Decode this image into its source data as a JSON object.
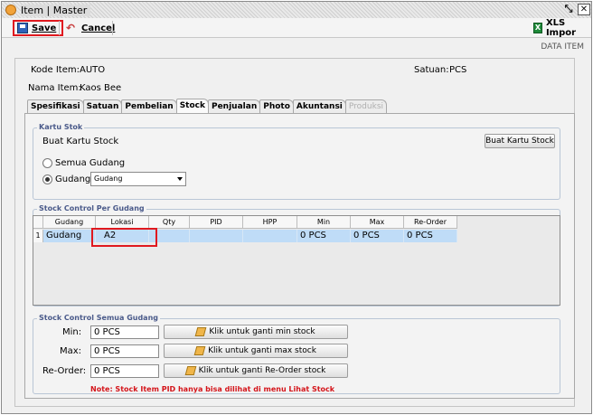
{
  "window": {
    "title": "Item | Master",
    "restore_icon": "restore-icon",
    "close_icon": "close-icon"
  },
  "toolbar": {
    "save_label": "Save",
    "cancel_label": "Cancel",
    "xls_label": "XLS Impor"
  },
  "header_caption": "DATA ITEM",
  "item": {
    "kode_label": "Kode Item:",
    "kode_value": "AUTO",
    "nama_label": "Nama Item:",
    "nama_value": "Kaos Bee",
    "satuan_label": "Satuan:",
    "satuan_value": "PCS"
  },
  "tabs": [
    {
      "label": "Spesifikasi",
      "active": false,
      "disabled": false
    },
    {
      "label": "Satuan",
      "active": false,
      "disabled": false
    },
    {
      "label": "Pembelian",
      "active": false,
      "disabled": false
    },
    {
      "label": "Stock",
      "active": true,
      "disabled": false
    },
    {
      "label": "Penjualan",
      "active": false,
      "disabled": false
    },
    {
      "label": "Photo",
      "active": false,
      "disabled": false
    },
    {
      "label": "Akuntansi",
      "active": false,
      "disabled": false
    },
    {
      "label": "Produksi",
      "active": false,
      "disabled": true
    }
  ],
  "kartu_stok": {
    "legend": "Kartu Stok",
    "subtitle": "Buat Kartu Stock",
    "button_label": "Buat Kartu Stock",
    "radio_all_label": "Semua Gudang",
    "radio_gudang_label": "Gudang:",
    "gudang_selected": "Gudang",
    "selected_option": "gudang"
  },
  "stock_control": {
    "legend": "Stock Control Per Gudang",
    "columns": [
      "Gudang",
      "Lokasi",
      "Qty",
      "PID",
      "HPP",
      "Min",
      "Max",
      "Re-Order"
    ],
    "rows": [
      {
        "index": "1",
        "cells": [
          "Gudang",
          "A2",
          "",
          "",
          "",
          "0 PCS",
          "0 PCS",
          "0 PCS"
        ]
      }
    ]
  },
  "stock_control_all": {
    "legend": "Stock Control Semua Gudang",
    "min_label": "Min:",
    "min_value": "0 PCS",
    "min_button": "Klik untuk ganti min stock",
    "max_label": "Max:",
    "max_value": "0 PCS",
    "max_button": "Klik untuk ganti max stock",
    "reorder_label": "Re-Order:",
    "reorder_value": "0 PCS",
    "reorder_button": "Klik untuk ganti Re-Order stock",
    "note": "Note: Stock Item PID hanya bisa dilihat di menu Lihat Stock"
  },
  "colors": {
    "highlight": "#e0191f",
    "row_selected": "#bfdcf7",
    "note": "#d4141a"
  }
}
